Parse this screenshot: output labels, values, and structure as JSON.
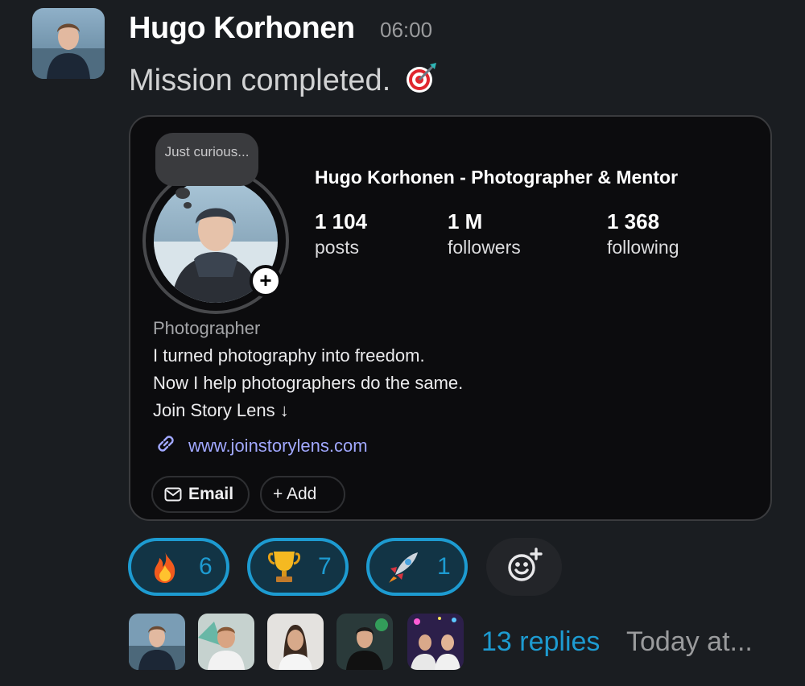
{
  "message": {
    "author": "Hugo Korhonen",
    "time": "06:00",
    "text": "Mission completed.",
    "emoji": "direct-hit-target-emoji"
  },
  "profile_card": {
    "thought_bubble": "Just curious...",
    "name": "Hugo Korhonen - Photographer & Mentor",
    "stats": [
      {
        "value": "1 104",
        "label": "posts"
      },
      {
        "value": "1 M",
        "label": "followers"
      },
      {
        "value": "1 368",
        "label": "following"
      }
    ],
    "bio_category": "Photographer",
    "bio_lines": [
      "I turned photography into freedom.",
      "Now I help photographers do the same.",
      "Join Story Lens ↓"
    ],
    "link": "www.joinstorylens.com",
    "buttons": {
      "email": "Email",
      "add": "+ Add"
    }
  },
  "reactions": [
    {
      "emoji": "fire-emoji",
      "count": "6"
    },
    {
      "emoji": "trophy-emoji",
      "count": "7"
    },
    {
      "emoji": "rocket-emoji",
      "count": "1"
    }
  ],
  "thread": {
    "replies": "13 replies",
    "last_reply": "Today at..."
  },
  "colors": {
    "background": "#1a1d21",
    "accent": "#1d9bd1",
    "reaction_bg": "#123445",
    "link": "#a1a8ff"
  }
}
